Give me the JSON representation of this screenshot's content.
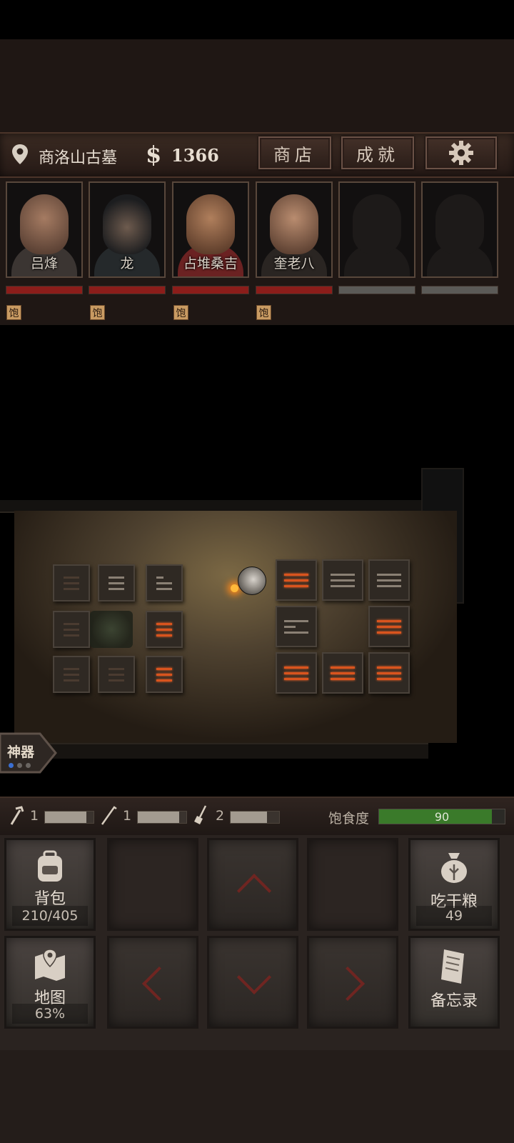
{
  "top_bar": {
    "location": "商洛山古墓",
    "money": "1366",
    "shop_label": "商店",
    "achievements_label": "成就"
  },
  "party": [
    {
      "name": "吕烽",
      "status": "饱",
      "hp": 1.0
    },
    {
      "name": "龙",
      "status": "饱",
      "hp": 1.0
    },
    {
      "name": "占堆桑吉",
      "status": "饱",
      "hp": 1.0
    },
    {
      "name": "奎老八",
      "status": "饱",
      "hp": 1.0
    },
    {
      "name": "",
      "status": "",
      "hp": 0
    },
    {
      "name": "",
      "status": "",
      "hp": 0
    }
  ],
  "artifact": {
    "label": "神器"
  },
  "resources": {
    "rope_count": "1",
    "pick_count": "1",
    "shovel_count": "2",
    "satiety_label": "饱食度",
    "satiety_value": "90"
  },
  "controls": {
    "backpack_label": "背包",
    "backpack_count": "210/405",
    "ration_label": "吃干粮",
    "ration_count": "49",
    "map_label": "地图",
    "map_progress": "63%",
    "memo_label": "备忘录"
  },
  "colors": {
    "hp_red": "#8b1d1a",
    "rune_lit": "#d9541e",
    "satiety_green": "#3a7a2a"
  }
}
